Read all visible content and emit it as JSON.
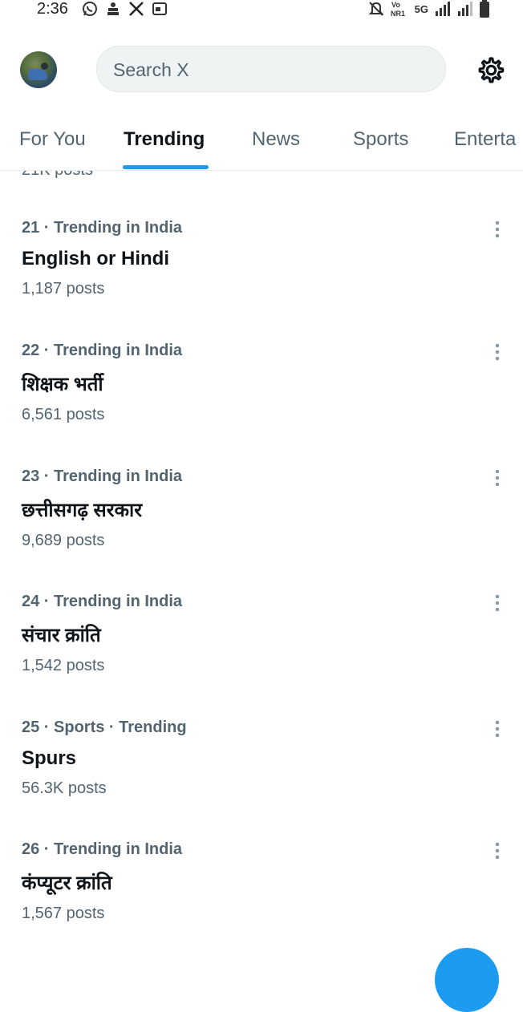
{
  "status_bar": {
    "time": "2:36",
    "left_icons": [
      "whatsapp-icon",
      "app-icon",
      "x-logo-icon",
      "calendar-icon"
    ],
    "network": "5G",
    "right_icons": [
      "mute-icon",
      "volte-icon",
      "signal-icon",
      "signal-icon",
      "battery-icon"
    ]
  },
  "header": {
    "search_placeholder": "Search X",
    "settings_icon": "gear-icon"
  },
  "tabs": [
    {
      "label": "For You",
      "active": false
    },
    {
      "label": "Trending",
      "active": true
    },
    {
      "label": "News",
      "active": false
    },
    {
      "label": "Sports",
      "active": false
    },
    {
      "label": "Enterta",
      "active": false
    }
  ],
  "feed": {
    "partial_count": "21K posts",
    "trends": [
      {
        "meta": "21 · Trending in India",
        "name": "English or Hindi",
        "count": "1,187 posts"
      },
      {
        "meta": "22 · Trending in India",
        "name": "शिक्षक भर्ती",
        "count": "6,561 posts"
      },
      {
        "meta": "23 · Trending in India",
        "name": "छत्तीसगढ़ सरकार",
        "count": "9,689 posts"
      },
      {
        "meta": "24 · Trending in India",
        "name": "संचार क्रांति",
        "count": "1,542 posts"
      },
      {
        "meta": "25 · Sports · Trending",
        "name": "Spurs",
        "count": "56.3K posts"
      },
      {
        "meta": "26 · Trending in India",
        "name": "कंप्यूटर क्रांति",
        "count": "1,567 posts"
      }
    ]
  },
  "colors": {
    "accent": "#1d9bf0",
    "text_primary": "#0f1419",
    "text_secondary": "#536471",
    "search_bg": "#eff3f4"
  }
}
